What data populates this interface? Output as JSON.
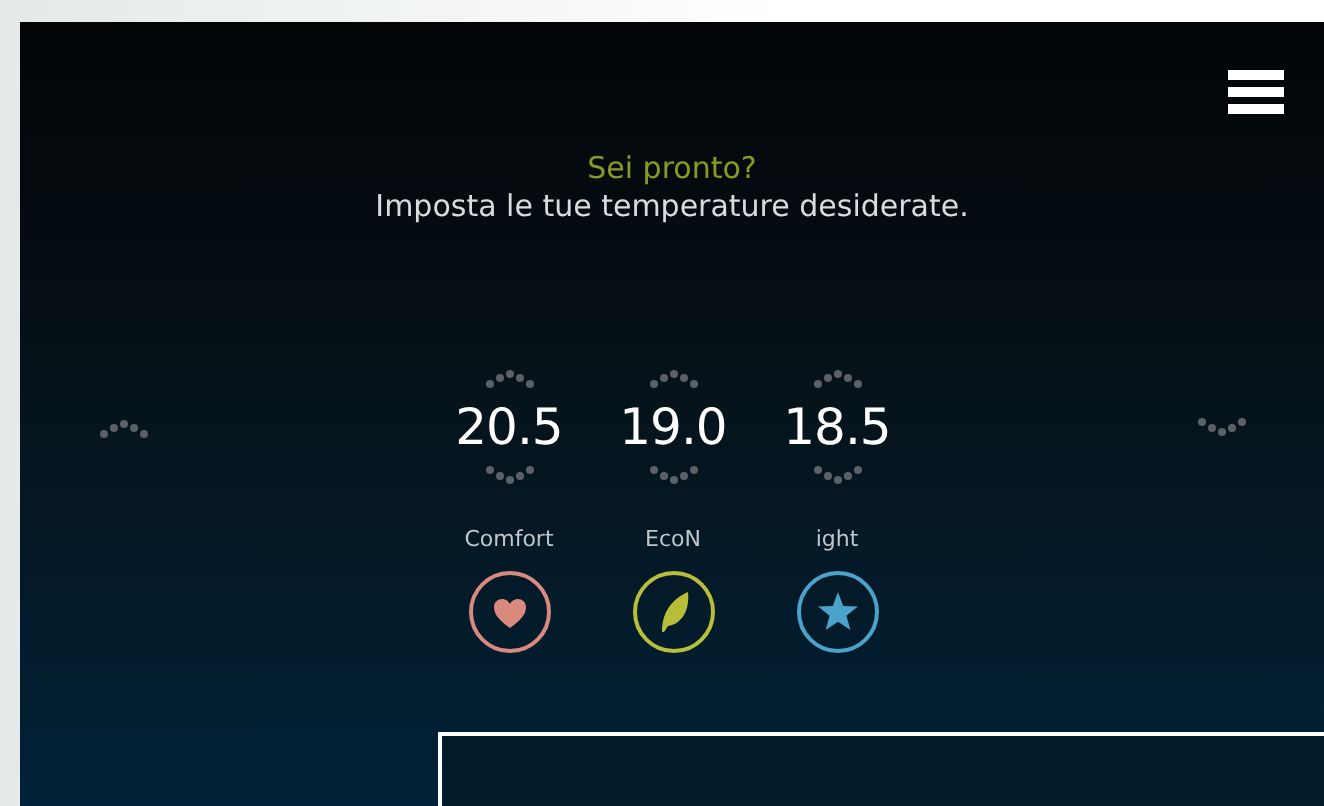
{
  "greeting": "Sei pronto?",
  "instruction": "Imposta le tue temperature desiderate.",
  "modes": [
    {
      "label": "Comfort",
      "temperature": "20.5",
      "kind": "heart",
      "color": "#d98a7e"
    },
    {
      "label": "EcoN",
      "temperature": "19.0",
      "kind": "leaf",
      "color": "#b8bd3a"
    },
    {
      "label": "ight",
      "temperature": "18.5",
      "kind": "star",
      "color": "#4ba3cc"
    }
  ]
}
